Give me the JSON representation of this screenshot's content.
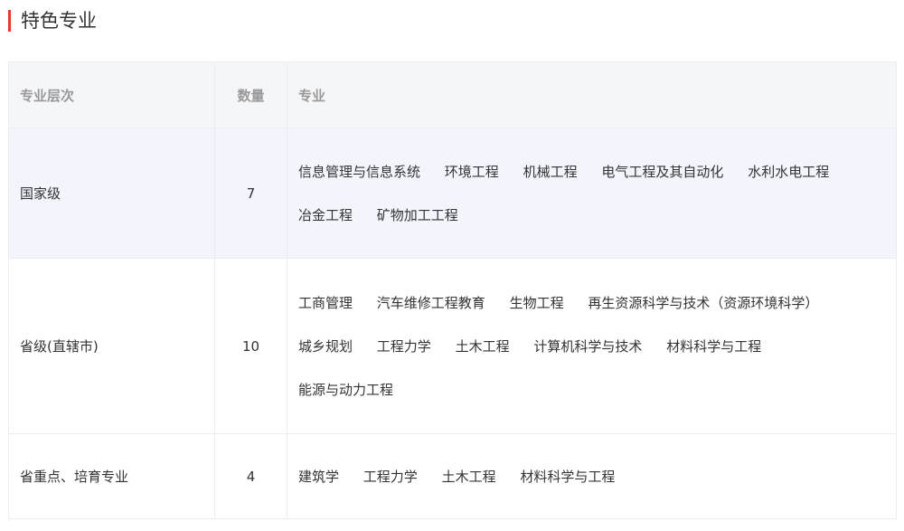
{
  "section": {
    "title": "特色专业"
  },
  "table": {
    "headers": {
      "level": "专业层次",
      "count": "数量",
      "majors": "专业"
    },
    "rows": [
      {
        "level": "国家级",
        "count": "7",
        "lines": [
          [
            "信息管理与信息系统",
            "环境工程",
            "机械工程",
            "电气工程及其自动化",
            "水利水电工程"
          ],
          [
            "冶金工程",
            "矿物加工工程"
          ]
        ]
      },
      {
        "level": "省级(直辖市)",
        "count": "10",
        "lines": [
          [
            "工商管理",
            "汽车维修工程教育",
            "生物工程",
            "再生资源科学与技术（资源环境科学）"
          ],
          [
            "城乡规划",
            "工程力学",
            "土木工程",
            "计算机科学与技术",
            "材料科学与工程"
          ],
          [
            "能源与动力工程"
          ]
        ]
      },
      {
        "level": "省重点、培育专业",
        "count": "4",
        "lines": [
          [
            "建筑学",
            "工程力学",
            "土木工程",
            "材料科学与工程"
          ]
        ]
      }
    ]
  },
  "colors": {
    "accent": "#e8382f",
    "header_bg": "#f5f6f8",
    "highlight_row_bg": "#f2f5fb",
    "border": "#eaecf0"
  }
}
